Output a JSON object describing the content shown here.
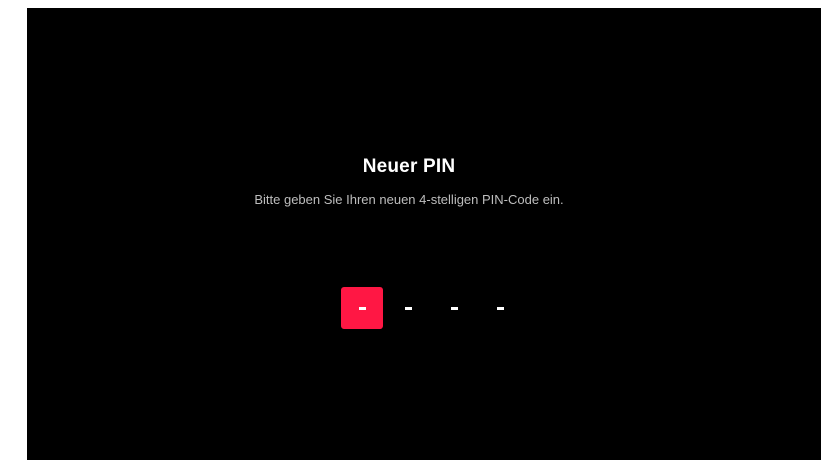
{
  "dialog": {
    "title": "Neuer PIN",
    "subtitle": "Bitte geben Sie Ihren neuen 4-stelligen PIN-Code ein."
  },
  "pin": {
    "length": 4,
    "active_index": 0,
    "placeholder": "-",
    "active_color": "#ff1744",
    "slots": [
      "-",
      "-",
      "-",
      "-"
    ]
  },
  "colors": {
    "background": "#000000",
    "text": "#ffffff",
    "subtext": "#bdbdbd"
  }
}
